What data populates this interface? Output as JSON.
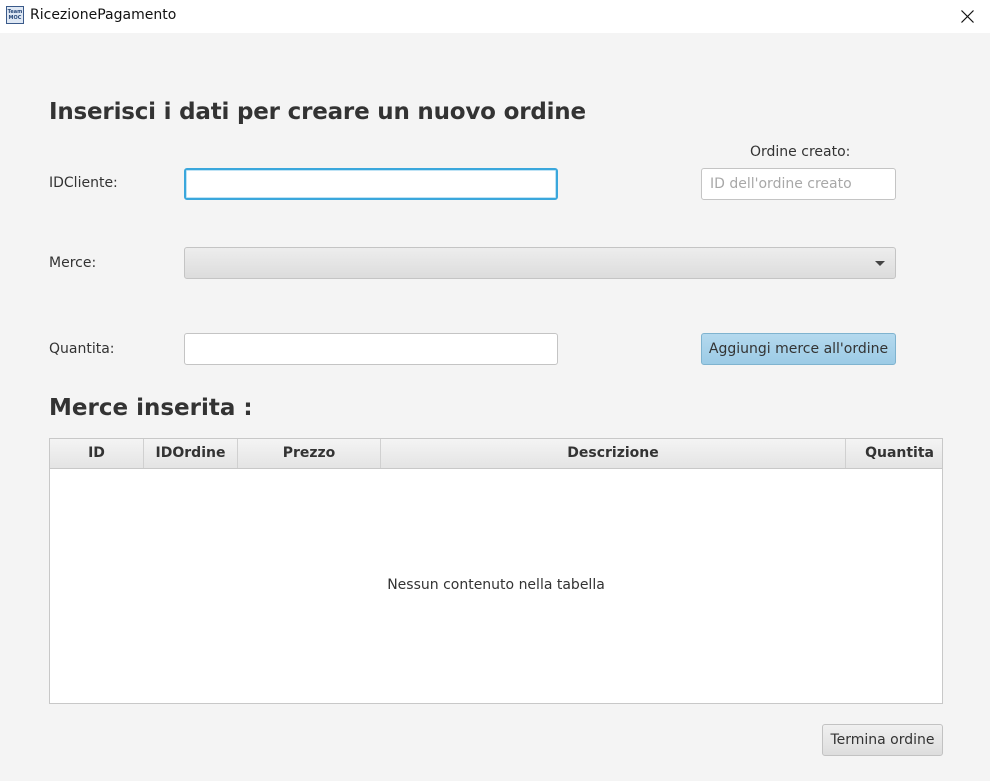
{
  "window": {
    "title": "RicezionePagamento",
    "icon_text_line1": "Team",
    "icon_text_line2": "MOC"
  },
  "form": {
    "heading": "Inserisci i dati per creare un nuovo ordine",
    "idcliente_label": "IDCliente:",
    "idcliente_value": "",
    "merce_label": "Merce:",
    "merce_selected": "",
    "quantita_label": "Quantita:",
    "quantita_value": "",
    "ordine_creato_label": "Ordine creato:",
    "ordine_creato_placeholder": "ID dell'ordine creato",
    "add_button_label": "Aggiungi merce all'ordine"
  },
  "table": {
    "heading": "Merce inserita :",
    "columns": [
      "ID",
      "IDOrdine",
      "Prezzo",
      "Descrizione",
      "Quantita"
    ],
    "rows": [],
    "empty_message": "Nessun contenuto nella tabella"
  },
  "footer": {
    "end_button_label": "Termina ordine"
  },
  "colors": {
    "focus_accent": "#3aa7dc",
    "default_button": "#a9d3ea",
    "background": "#f4f4f4"
  }
}
